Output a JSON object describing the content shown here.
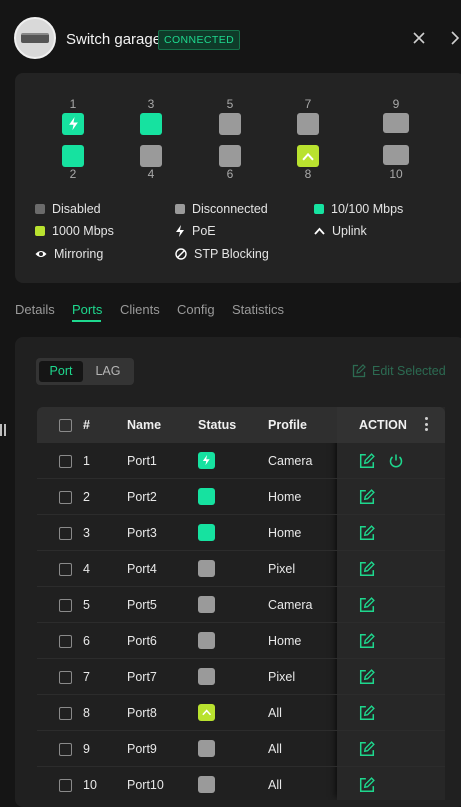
{
  "header": {
    "title": "Switch garage",
    "status_badge": "CONNECTED"
  },
  "ports_panel": {
    "ports": [
      {
        "num": "1",
        "status": "poe"
      },
      {
        "num": "2",
        "status": "10100"
      },
      {
        "num": "3",
        "status": "10100"
      },
      {
        "num": "4",
        "status": "disconnected"
      },
      {
        "num": "5",
        "status": "disconnected"
      },
      {
        "num": "6",
        "status": "disconnected"
      },
      {
        "num": "7",
        "status": "disconnected"
      },
      {
        "num": "8",
        "status": "uplink"
      },
      {
        "num": "9",
        "status": "disconnected"
      },
      {
        "num": "10",
        "status": "disconnected"
      }
    ],
    "legend": {
      "disabled": "Disabled",
      "disconnected": "Disconnected",
      "m10100": "10/100 Mbps",
      "m1000": "1000 Mbps",
      "poe": "PoE",
      "uplink": "Uplink",
      "mirroring": "Mirroring",
      "stp": "STP Blocking"
    }
  },
  "tabs": [
    "Details",
    "Ports",
    "Clients",
    "Config",
    "Statistics"
  ],
  "active_tab": "Ports",
  "toolbar": {
    "seg_port": "Port",
    "seg_lag": "LAG",
    "edit_selected": "Edit Selected"
  },
  "table": {
    "headers": {
      "num": "#",
      "name": "Name",
      "status": "Status",
      "profile": "Profile",
      "action": "ACTION"
    },
    "rows": [
      {
        "num": "1",
        "name": "Port1",
        "status": "poe",
        "profile": "Camera"
      },
      {
        "num": "2",
        "name": "Port2",
        "status": "10100",
        "profile": "Home"
      },
      {
        "num": "3",
        "name": "Port3",
        "status": "10100",
        "profile": "Home"
      },
      {
        "num": "4",
        "name": "Port4",
        "status": "disconnected",
        "profile": "Pixel"
      },
      {
        "num": "5",
        "name": "Port5",
        "status": "disconnected",
        "profile": "Camera"
      },
      {
        "num": "6",
        "name": "Port6",
        "status": "disconnected",
        "profile": "Home"
      },
      {
        "num": "7",
        "name": "Port7",
        "status": "disconnected",
        "profile": "Pixel"
      },
      {
        "num": "8",
        "name": "Port8",
        "status": "uplink",
        "profile": "All"
      },
      {
        "num": "9",
        "name": "Port9",
        "status": "disconnected",
        "profile": "All"
      },
      {
        "num": "10",
        "name": "Port10",
        "status": "disconnected",
        "profile": "All"
      }
    ]
  },
  "colors": {
    "accent": "#1ed88e",
    "speed_10100": "#16e2a0",
    "speed_1000": "#b9e22f",
    "disconnected": "#9a9a9a",
    "disabled": "#6b6b6b"
  }
}
